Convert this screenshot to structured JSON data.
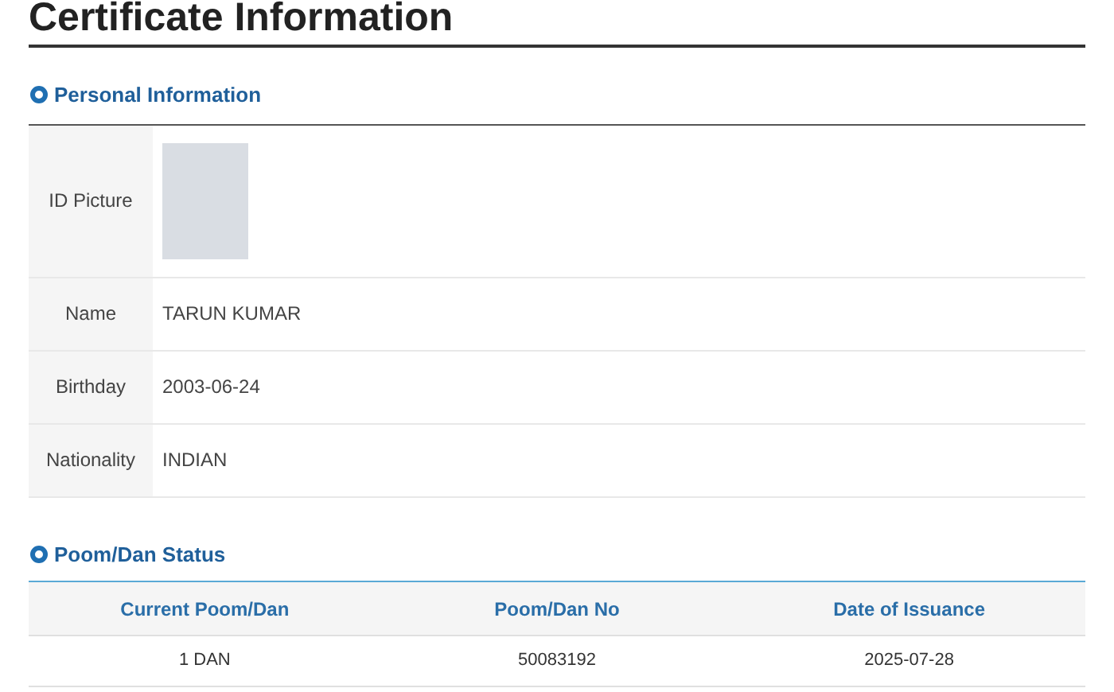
{
  "page_title": "Certificate Information",
  "personal_information": {
    "heading": "Personal Information",
    "rows": [
      {
        "kind": "photo",
        "label": "ID Picture"
      },
      {
        "kind": "text",
        "label": "Name",
        "value": "TARUN KUMAR"
      },
      {
        "kind": "text",
        "label": "Birthday",
        "value": "2003-06-24"
      },
      {
        "kind": "text",
        "label": "Nationality",
        "value": "INDIAN"
      }
    ]
  },
  "poom_dan_status": {
    "heading": "Poom/Dan Status",
    "columns": [
      "Current Poom/Dan",
      "Poom/Dan No",
      "Date of Issuance"
    ],
    "rows": [
      [
        "1 DAN",
        "50083192",
        "2025-07-28"
      ]
    ]
  }
}
